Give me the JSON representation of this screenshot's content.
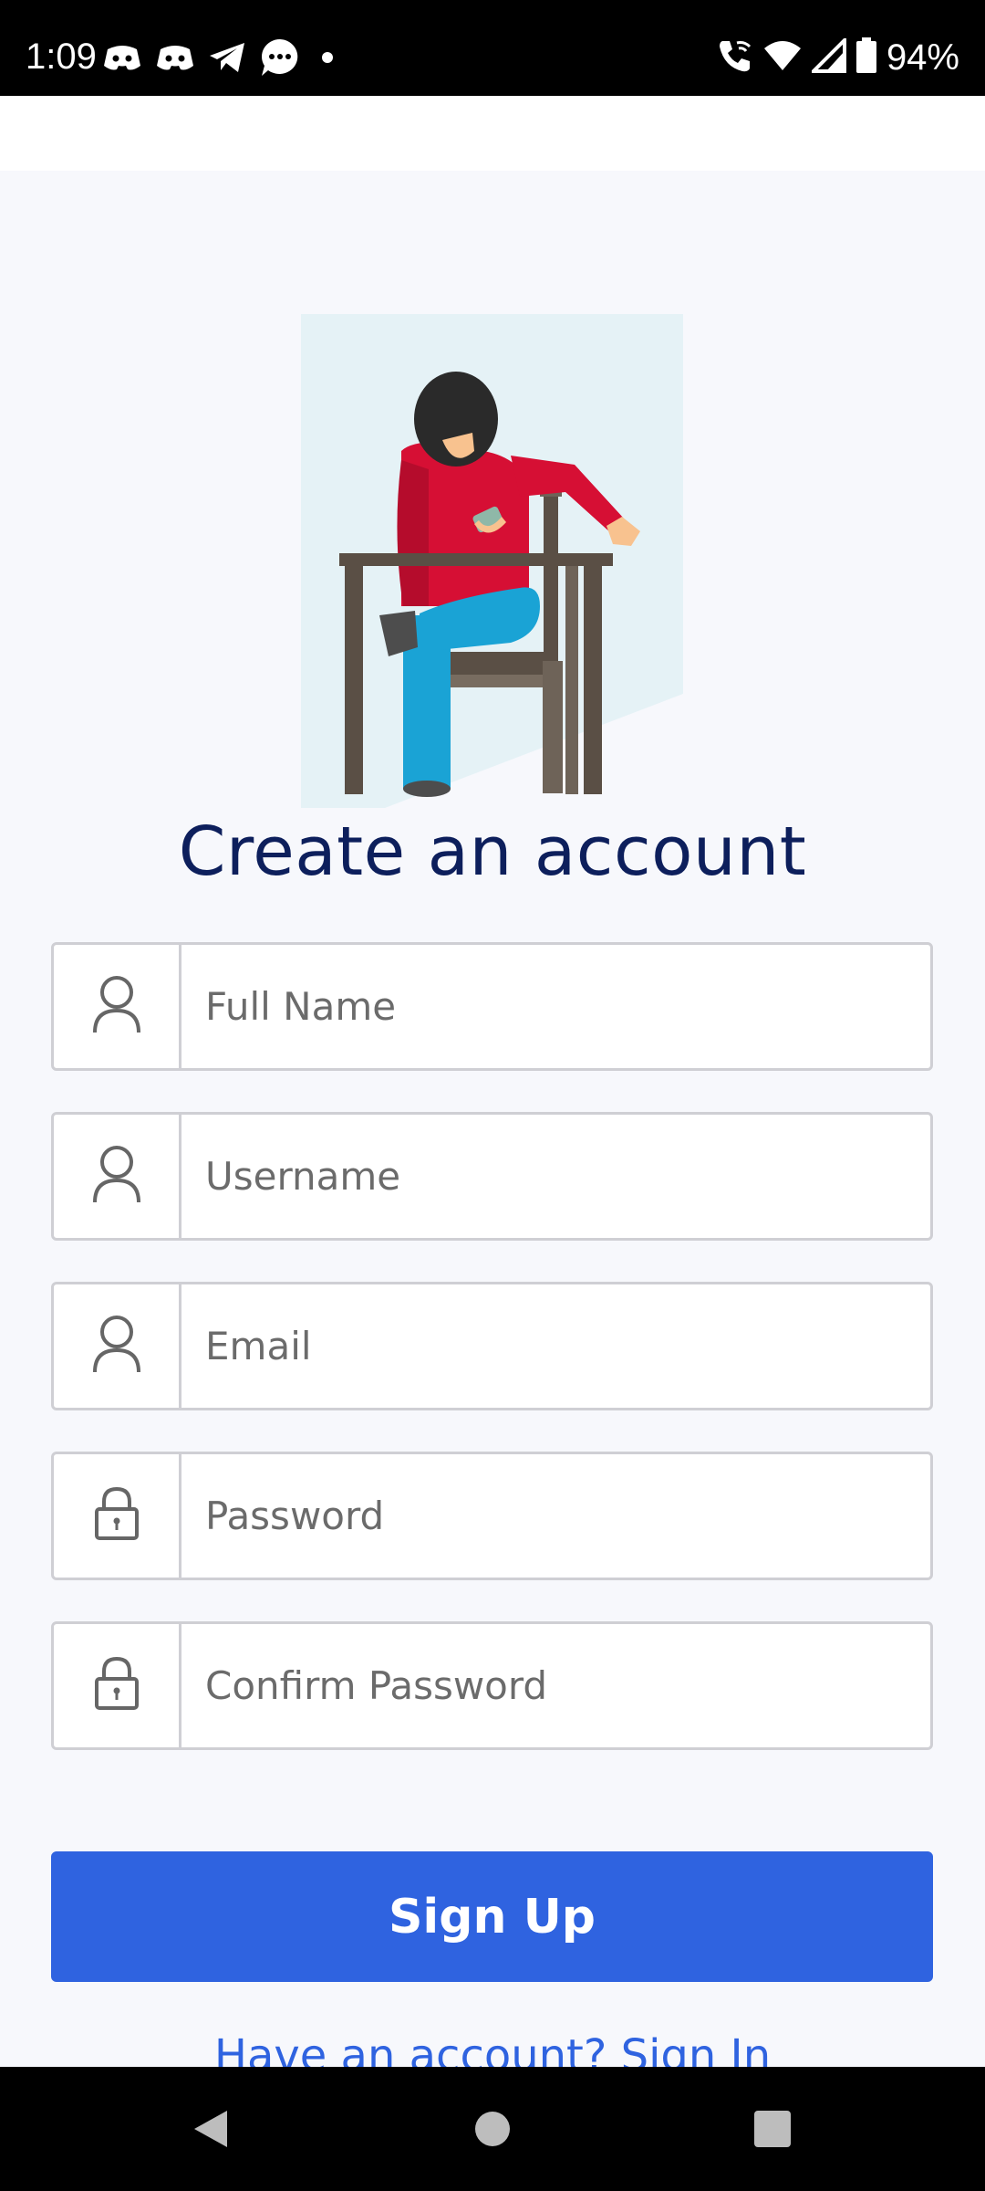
{
  "status_bar": {
    "time": "1:09",
    "battery": "94%",
    "icons": [
      "discord-icon",
      "discord-icon",
      "telegram-icon",
      "chat-bubble-icon",
      "dot-icon",
      "wifi-call-icon",
      "wifi-icon",
      "cell-signal-icon",
      "battery-icon"
    ]
  },
  "page": {
    "title": "Create an account"
  },
  "form": {
    "fields": [
      {
        "placeholder": "Full Name",
        "icon": "person-icon"
      },
      {
        "placeholder": "Username",
        "icon": "person-icon"
      },
      {
        "placeholder": "Email",
        "icon": "person-icon"
      },
      {
        "placeholder": "Password",
        "icon": "lock-icon"
      },
      {
        "placeholder": "Confirm Password",
        "icon": "lock-icon"
      }
    ],
    "submit_label": "Sign Up",
    "signin_link": "Have an account? Sign In"
  },
  "nav_bar": {
    "buttons": [
      "back-icon",
      "home-icon",
      "recents-icon"
    ]
  },
  "colors": {
    "accent": "#2f63e0",
    "title": "#0d1f5c",
    "background": "#f7f8fc"
  }
}
